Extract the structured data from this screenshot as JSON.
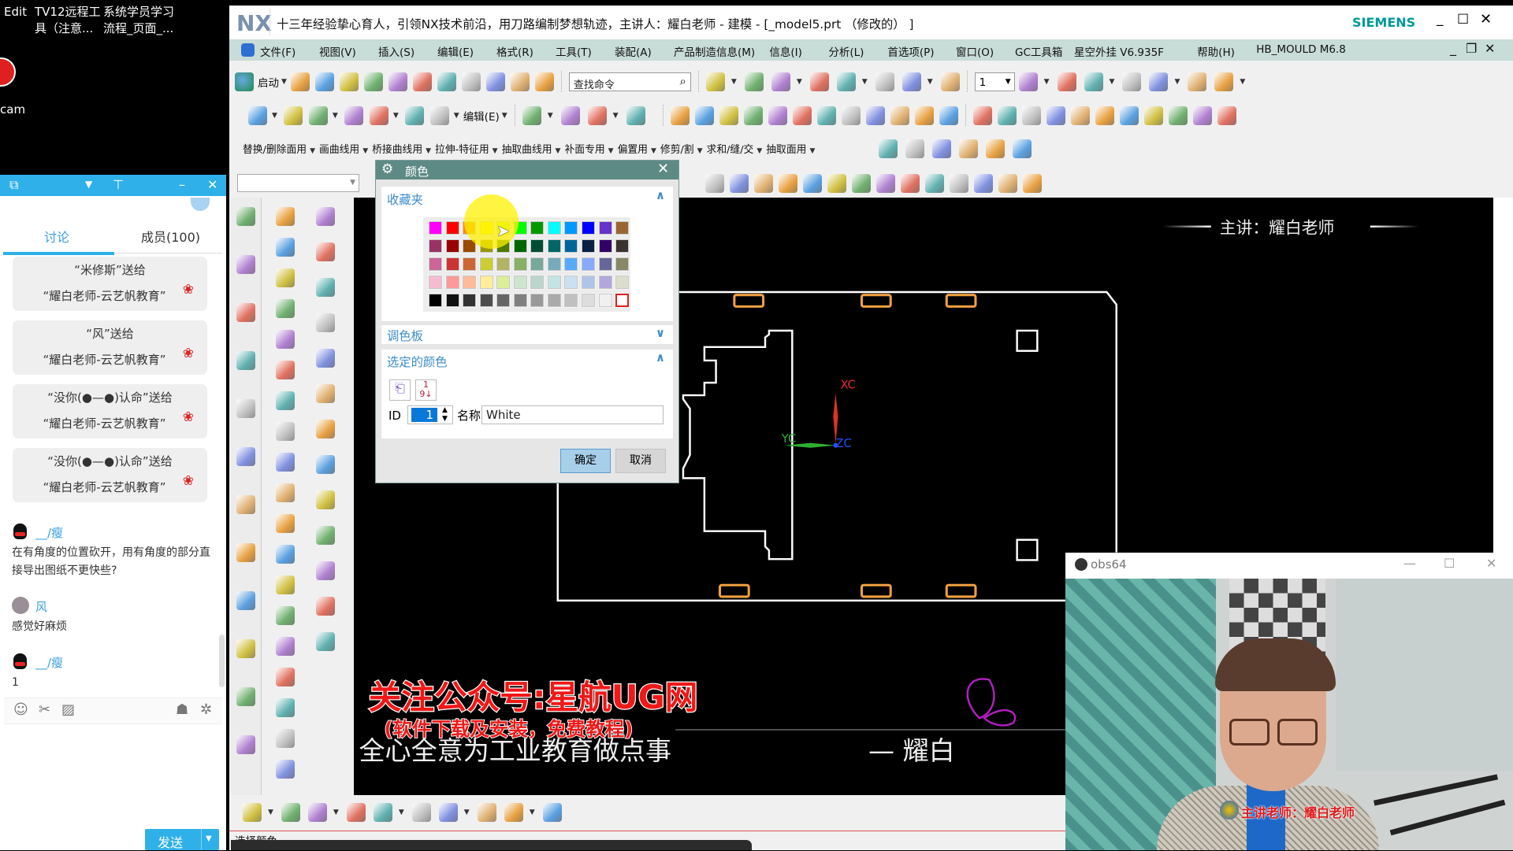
{
  "desktop": {
    "icons": [
      {
        "line1": "Edit",
        "line2": ""
      },
      {
        "line1": "TV12远程工",
        "line2": "具（注意..."
      },
      {
        "line1": "系统学员学习",
        "line2": "流程_页面_..."
      }
    ],
    "cam_label": "cam"
  },
  "chat": {
    "header_icons": [
      "share-icon",
      "dropdown-icon",
      "pin-icon",
      "minimize-icon",
      "close-icon"
    ],
    "tabs": [
      {
        "label": "讨论",
        "active": true
      },
      {
        "label": "成员(100)",
        "active": false
      }
    ],
    "gifts": [
      {
        "from": "“米修斯”送给",
        "to": "“耀白老师-云艺帆教育”"
      },
      {
        "from": "“风”送给",
        "to": "“耀白老师-云艺帆教育”"
      },
      {
        "from": "“没你(●—●)认命”送给",
        "to": "“耀白老师-云艺帆教育”"
      },
      {
        "from": "“没你(●—●)认命”送给",
        "to": "“耀白老师-云艺帆教育”"
      }
    ],
    "messages": [
      {
        "user": "__/瘦",
        "text": "在有角度的位置砍开，用有角度的部分直接导出图纸不更快些?"
      },
      {
        "user": "风",
        "text": "感觉好麻烦"
      },
      {
        "user": "__/瘦",
        "text": "1"
      }
    ],
    "send_label": "发送",
    "accent": "#2fb0e8"
  },
  "nx": {
    "logo": "NX",
    "title": "十三年经验挚心育人，引领NX技术前沿，用刀路编制梦想轨迹，主讲人：耀白老师 - 建模 - [_model5.prt （修改的） ]",
    "brand": "SIEMENS",
    "brand_color": "#009999",
    "menu": [
      "文件(F)",
      "视图(V)",
      "插入(S)",
      "编辑(E)",
      "格式(R)",
      "工具(T)",
      "装配(A)",
      "产品制造信息(M)",
      "信息(I)",
      "分析(L)",
      "首选项(P)",
      "窗口(O)",
      "GC工具箱",
      "星空外挂 V6.935F",
      "帮助(H)",
      "HB_MOULD M6.8"
    ],
    "toolbar1": {
      "start_label": "启动",
      "search_placeholder": "查找命令",
      "layer_value": "1",
      "icons_a": [
        "new-file",
        "open-folder",
        "save",
        "cut",
        "copy",
        "paste",
        "undo",
        "redo",
        "repeat-command",
        "touch-mode",
        "window-split"
      ],
      "icons_b": [
        "fit-view",
        "render-style",
        "shaded",
        "wireframe",
        "hidden",
        "background",
        "section-view",
        "clip-section"
      ],
      "icons_c": [
        "layer-settings",
        "wcs-dynamic",
        "show-hide",
        "measure-distance",
        "move-object",
        "point-dialog",
        "dimension"
      ]
    },
    "toolbar2": {
      "edit_label": "编辑(E)",
      "icons_a": [
        "sketch-plane",
        "extrude",
        "move-face",
        "sphere",
        "block",
        "sew",
        "offset-face"
      ],
      "icons_b": [
        "bounded-plane",
        "ruled-surface",
        "through-curves",
        "trim-sheet"
      ],
      "icons_c": [
        "unite",
        "subtract",
        "intersect",
        "trim-body",
        "split-body",
        "draft",
        "blend",
        "chamfer",
        "shell",
        "offset-region",
        "replace-face",
        "pattern-face"
      ],
      "icons_d": [
        "line",
        "rectangle",
        "arc",
        "text",
        "fillet-curve",
        "bridge-curve",
        "project-curve",
        "intersection-curve",
        "section-curve",
        "extract-curve",
        "combined-projection"
      ]
    },
    "toolbar3": [
      "替换/删除面用",
      "画曲线用",
      "桥接曲线用",
      "拉伸-特征用",
      "抽取曲线用",
      "补面专用",
      "偏置用",
      "修剪/割",
      "求和/缝/交",
      "抽取面用"
    ],
    "toolbar3_icons": [
      "edit-section",
      "draft-analysis",
      "trim-curve",
      "divide-curve",
      "curve-length",
      "join-curve"
    ],
    "toolbar4_icons": [
      "solid-view",
      "block-view",
      "snap-point",
      "snap-end",
      "snap-mid",
      "snap-control",
      "snap-intersection",
      "snap-center",
      "snap-quadrant",
      "snap-existing",
      "snap-on-curve",
      "snap-face",
      "snap-bounded",
      "snap-options"
    ],
    "resource_bar_icons": [
      "settings",
      "assembly-navigator",
      "constraint-navigator",
      "part-navigator",
      "reuse-library",
      "hd3d-tools",
      "web-browser",
      "history",
      "system-materials",
      "process-studio",
      "manufacturing-wizard",
      "roles"
    ],
    "left_col1_icons": [
      "fillet",
      "extrude-feature",
      "revolve",
      "hole",
      "boss",
      "pocket",
      "pad",
      "shell-body",
      "array-feature",
      "mirror",
      "thicken",
      "trim",
      "split",
      "blend-face",
      "chamfer-feature",
      "draft-feature",
      "offset",
      "patch",
      "unite-body"
    ],
    "left_col2_icons": [
      "datum-plane",
      "mesh-surface",
      "studio-surface",
      "n-sided",
      "law-extension",
      "extension",
      "section-surface",
      "swept",
      "variational-sweep",
      "styled-blend",
      "flange",
      "transition",
      "ruled"
    ],
    "bottom_icons": [
      "relate-face",
      "offset-dimension",
      "annotation",
      "simplify",
      "wave-link",
      "paint",
      "sheet-metal",
      "text-annotation",
      "magnify-text",
      "text-rotate"
    ],
    "status_text": "选择颜色"
  },
  "dialog": {
    "title": "颜色",
    "favorites_label": "收藏夹",
    "palette_label": "调色板",
    "selected_label": "选定的颜色",
    "id_label": "ID",
    "id_value": "1",
    "name_label": "名称",
    "name_value": "White",
    "ok_label": "确定",
    "cancel_label": "取消",
    "selected_swatch": [
      4,
      11
    ],
    "favorites": [
      [
        "#ff00ff",
        "#ff0000",
        "#ff8c00",
        "#ffff00",
        "#ccff33",
        "#00ff00",
        "#009900",
        "#00ffff",
        "#0099ff",
        "#0000ff",
        "#6633cc",
        "#996633"
      ],
      [
        "#993366",
        "#990000",
        "#994c00",
        "#999900",
        "#4d7a00",
        "#006600",
        "#004d33",
        "#006666",
        "#006699",
        "#0a1f44",
        "#330066",
        "#3a3330"
      ],
      [
        "#cc6699",
        "#cc3333",
        "#cc6633",
        "#cccc33",
        "#b3b366",
        "#88b066",
        "#77a899",
        "#77aabb",
        "#55aaff",
        "#88aaff",
        "#666699",
        "#888866"
      ],
      [
        "#f5bbd0",
        "#ff9999",
        "#ffbb99",
        "#ffee99",
        "#ddee99",
        "#cce6cc",
        "#bbd6cc",
        "#c4e4e4",
        "#cce0f0",
        "#b0c4e8",
        "#b0a8dd",
        "#ddddcc"
      ],
      [
        "#000000",
        "#111111",
        "#333333",
        "#4d4d4d",
        "#666666",
        "#808080",
        "#999999",
        "#aaaaaa",
        "#c0c0c0",
        "#dddddd",
        "#f0f0f0",
        "#ffffff"
      ]
    ]
  },
  "viewport": {
    "presenter": "主讲：耀白老师",
    "watermark": "关注公众号:星航UG网",
    "watermark_sub": "(软件下载及安装，免费教程)",
    "slogan": "全心全意为工业教育做点事",
    "signature": "— 耀白",
    "axes": {
      "x": "XC",
      "y": "YC",
      "z": "ZC"
    },
    "colors": {
      "geometry": "#ffffff",
      "slots": "#f0a040",
      "x_axis": "#e03030",
      "y_axis": "#30b030",
      "z_axis": "#2050ff"
    }
  },
  "obs": {
    "title": "obs64",
    "caption": "主讲老师：耀白老师"
  }
}
